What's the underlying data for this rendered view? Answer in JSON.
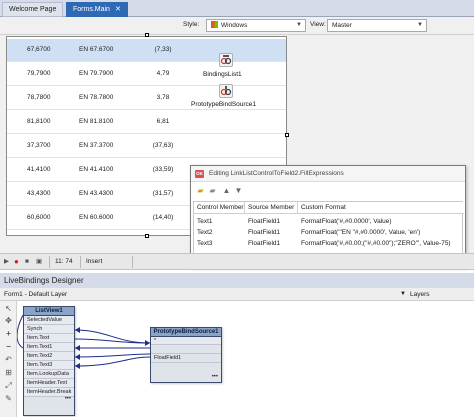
{
  "tabs": [
    {
      "label": "Welcome Page"
    },
    {
      "label": "Forms.Main"
    }
  ],
  "stylebar": {
    "style_label": "Style:",
    "style_value": "Windows",
    "view_label": "View:",
    "view_value": "Master"
  },
  "grid_rows": [
    {
      "a": "67,6700",
      "b": "EN 67.6700",
      "c": "(7,33)"
    },
    {
      "a": "79,7900",
      "b": "EN 79.7900",
      "c": "4,79"
    },
    {
      "a": "78,7800",
      "b": "EN 78.7800",
      "c": "3,78"
    },
    {
      "a": "81,8100",
      "b": "EN 81.8100",
      "c": "6,81"
    },
    {
      "a": "37,3700",
      "b": "EN 37.3700",
      "c": "(37,63)"
    },
    {
      "a": "41,4100",
      "b": "EN 41.4100",
      "c": "(33,59)"
    },
    {
      "a": "43,4300",
      "b": "EN 43.4300",
      "c": "(31,57)"
    },
    {
      "a": "60,6000",
      "b": "EN 60.6000",
      "c": "(14,40)"
    }
  ],
  "components": {
    "bindings_list": "BindingsList1",
    "bind_source": "PrototypeBindSource1"
  },
  "dialog": {
    "title": "Editing LinkListControlToField2.FillExpressions",
    "icon_text": "OK",
    "columns": [
      "Control Member",
      "Source Member",
      "Custom Format"
    ],
    "rows": [
      {
        "control": "Text1",
        "source": "FloatField1",
        "format": "FormatFloat('#,#0.0000', Value)"
      },
      {
        "control": "Text2",
        "source": "FloatField1",
        "format": "FormatFloat('\"EN \"#,#0.0000', Value, 'en')"
      },
      {
        "control": "Text3",
        "source": "FloatField1",
        "format": "FormatFloat('#,#0.00;(\"#,#0.00\");\"ZERO\"', Value-75)"
      }
    ]
  },
  "statusbar": {
    "position": "11:  74",
    "mode": "Insert"
  },
  "livebindings": {
    "title": "LiveBindings Designer",
    "layer_name": "Form1  - Default Layer",
    "layers_label": "Layers",
    "listview": {
      "title": "ListView1",
      "items": [
        "SelectedValue",
        "Synch",
        "Item.Text",
        "Item.Text1",
        "Item.Text2",
        "Item.Text3",
        "Item.LookupData",
        "ItemHeader.Text",
        "ItemHeader.Break"
      ],
      "more": "•••"
    },
    "bindsource": {
      "title": "PrototypeBindSource1",
      "items": [
        "*",
        "",
        "FloatField1",
        ""
      ],
      "more": "•••"
    }
  },
  "colors": {
    "tab_active": "#2d6ab3",
    "selected_row": "#cfe0f5",
    "node_header": "#8aa3c8",
    "link_line": "#1c2f8a"
  }
}
